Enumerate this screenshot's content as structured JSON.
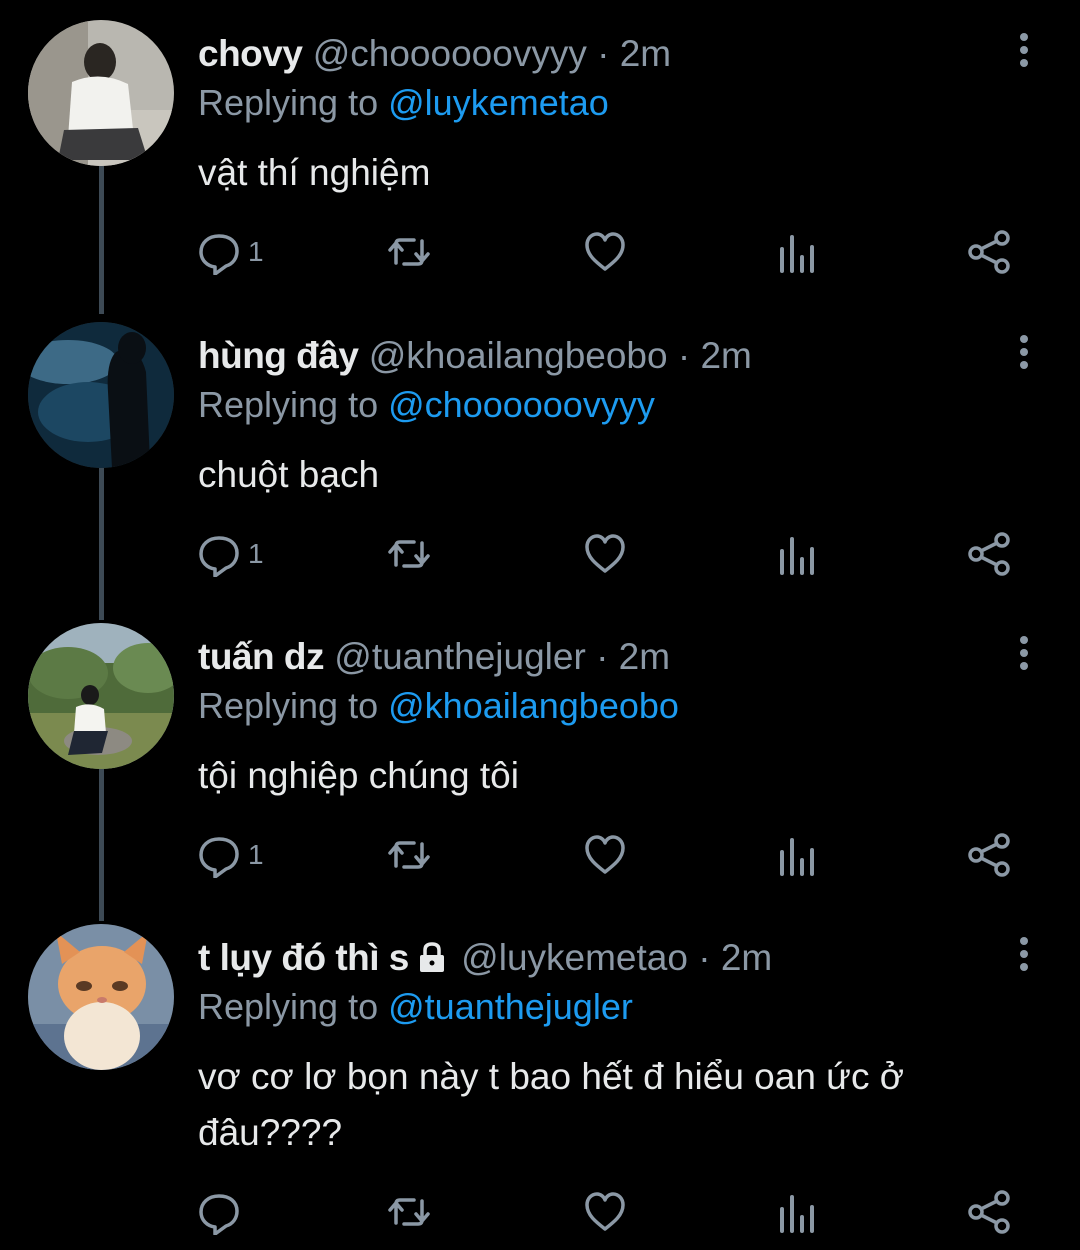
{
  "tweets": [
    {
      "display_name": "chovy",
      "handle": "@choooooovyyy",
      "separator": "·",
      "time": "2m",
      "reply_prefix": "Replying to",
      "reply_to": "@luykemetao",
      "text": "vật thí nghiệm",
      "reply_count": "1",
      "locked": false
    },
    {
      "display_name": "hùng đây",
      "handle": "@khoailangbeobo",
      "separator": "·",
      "time": "2m",
      "reply_prefix": "Replying to",
      "reply_to": "@choooooovyyy",
      "text": "chuột bạch",
      "reply_count": "1",
      "locked": false
    },
    {
      "display_name": "tuấn dz",
      "handle": "@tuanthejugler",
      "separator": "·",
      "time": "2m",
      "reply_prefix": "Replying to",
      "reply_to": "@khoailangbeobo",
      "text": "tội nghiệp chúng tôi",
      "reply_count": "1",
      "locked": false
    },
    {
      "display_name": "t lụy đó thì s",
      "handle": "@luykemetao",
      "separator": "·",
      "time": "2m",
      "reply_prefix": "Replying to",
      "reply_to": "@tuanthejugler",
      "text": "vơ cơ lơ bọn này t bao hết đ hiểu oan ức ở đâu????",
      "reply_count": "",
      "locked": true
    }
  ],
  "icons": {
    "more": "more-vertical-icon",
    "reply": "reply-bubble-icon",
    "retweet": "retweet-icon",
    "like": "heart-icon",
    "views": "views-bar-chart-icon",
    "share": "share-icon",
    "lock": "lock-icon"
  },
  "colors": {
    "background": "#000000",
    "primary_text": "#e7e9ea",
    "secondary_text": "#8b98a5",
    "link": "#1d9bf0",
    "thread_line": "#3d4a55"
  }
}
